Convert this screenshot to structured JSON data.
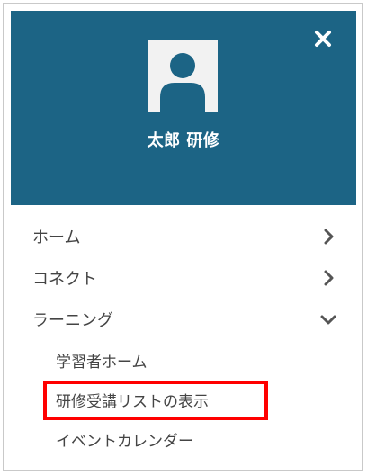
{
  "profile": {
    "user_name": "太郎 研修",
    "header_color": "#1c6485"
  },
  "nav": {
    "items": [
      {
        "label": "ホーム",
        "chevron": "chevron-right-icon"
      },
      {
        "label": "コネクト",
        "chevron": "chevron-right-icon"
      },
      {
        "label": "ラーニング",
        "chevron": "chevron-down-icon",
        "expanded": true
      }
    ],
    "learning_subitems": [
      {
        "label": "学習者ホーム"
      },
      {
        "label": "研修受講リストの表示",
        "highlighted": true,
        "highlight_color": "#ff0000"
      },
      {
        "label": "イベントカレンダー"
      }
    ]
  }
}
